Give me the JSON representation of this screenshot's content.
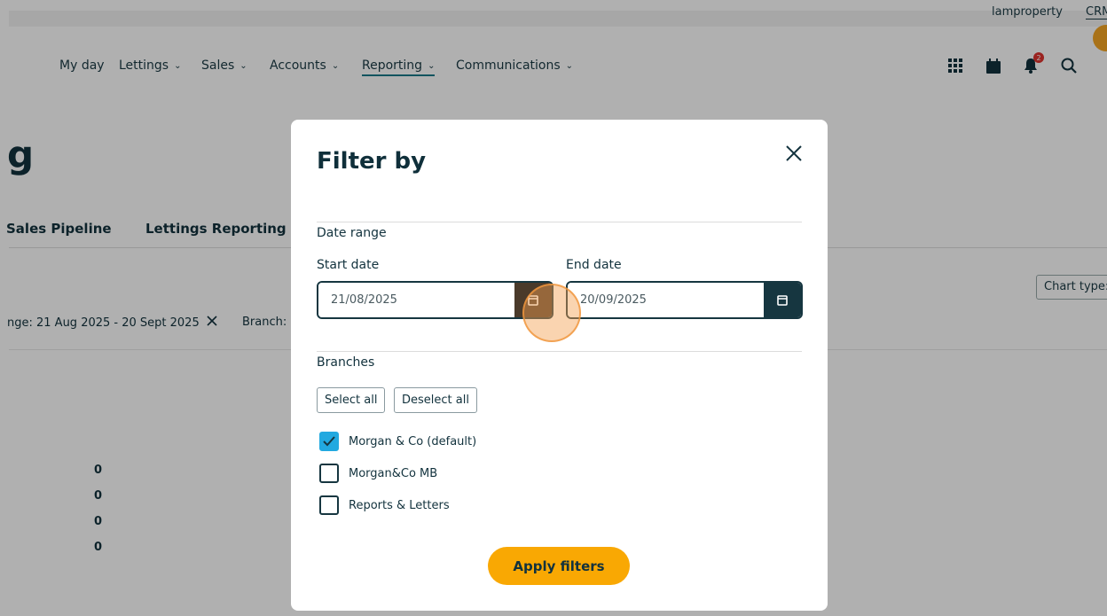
{
  "topbar": {
    "account": "lamproperty",
    "crm": "CRM"
  },
  "nav": {
    "items": [
      {
        "label": "My day"
      },
      {
        "label": "Lettings"
      },
      {
        "label": "Sales"
      },
      {
        "label": "Accounts"
      },
      {
        "label": "Reporting"
      },
      {
        "label": "Communications"
      }
    ],
    "notification_count": "2",
    "icons": [
      "apps-grid-icon",
      "calendar-icon",
      "bell-icon",
      "search-icon"
    ]
  },
  "page": {
    "logo_text": "g",
    "tabs": [
      "Sales Pipeline",
      "Lettings Reporting"
    ],
    "chart_type_label": "Chart type:",
    "filter_chip_range": "nge: 21 Aug 2025 - 20 Sept 2025",
    "filter_chip_branch": "Branch: M",
    "values": [
      "0",
      "0",
      "0",
      "0"
    ]
  },
  "modal": {
    "title": "Filter by",
    "date_range_label": "Date range",
    "start_label": "Start date",
    "start_value": "21/08/2025",
    "end_label": "End date",
    "end_value": "20/09/2025",
    "branches_label": "Branches",
    "select_all": "Select all",
    "deselect_all": "Deselect all",
    "branches": [
      {
        "label": "Morgan & Co (default)",
        "checked": true
      },
      {
        "label": "Morgan&Co MB",
        "checked": false
      },
      {
        "label": "Reports & Letters",
        "checked": false
      }
    ],
    "apply_label": "Apply filters"
  },
  "colors": {
    "primary_dark": "#163640",
    "accent_orange": "#f9a803",
    "checkbox_blue": "#22a9e0"
  }
}
